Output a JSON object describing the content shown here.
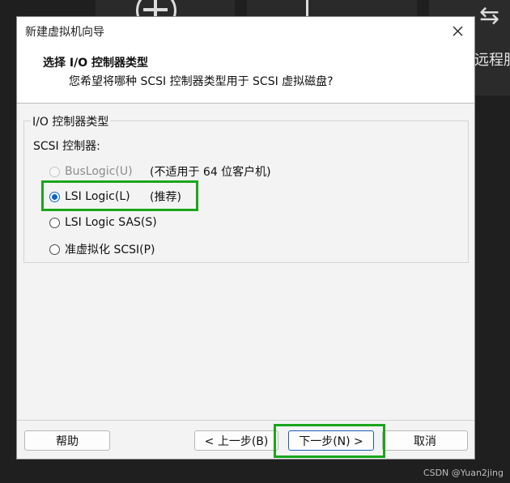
{
  "background": {
    "remote_text": "远程服"
  },
  "dialog": {
    "title": "新建虚拟机向导",
    "header_title": "选择 I/O 控制器类型",
    "header_subtitle": "您希望将哪种 SCSI 控制器类型用于 SCSI 虚拟磁盘?",
    "group_label": "I/O 控制器类型",
    "scsi_label": "SCSI 控制器:",
    "options": [
      {
        "label": "BusLogic(U)",
        "note": "(不适用于 64 位客户机)",
        "state": "disabled"
      },
      {
        "label": "LSI Logic(L)",
        "note": "(推荐)",
        "state": "selected"
      },
      {
        "label": "LSI Logic SAS(S)",
        "note": "",
        "state": "enabled"
      },
      {
        "label": "准虚拟化 SCSI(P)",
        "note": "",
        "state": "enabled"
      }
    ],
    "buttons": {
      "help": "帮助",
      "back": "< 上一步(B)",
      "next": "下一步(N) >",
      "cancel": "取消"
    }
  },
  "colors": {
    "highlight": "#1aa51a",
    "accent": "#0a64c8"
  },
  "watermark": "CSDN @Yuan2jing"
}
